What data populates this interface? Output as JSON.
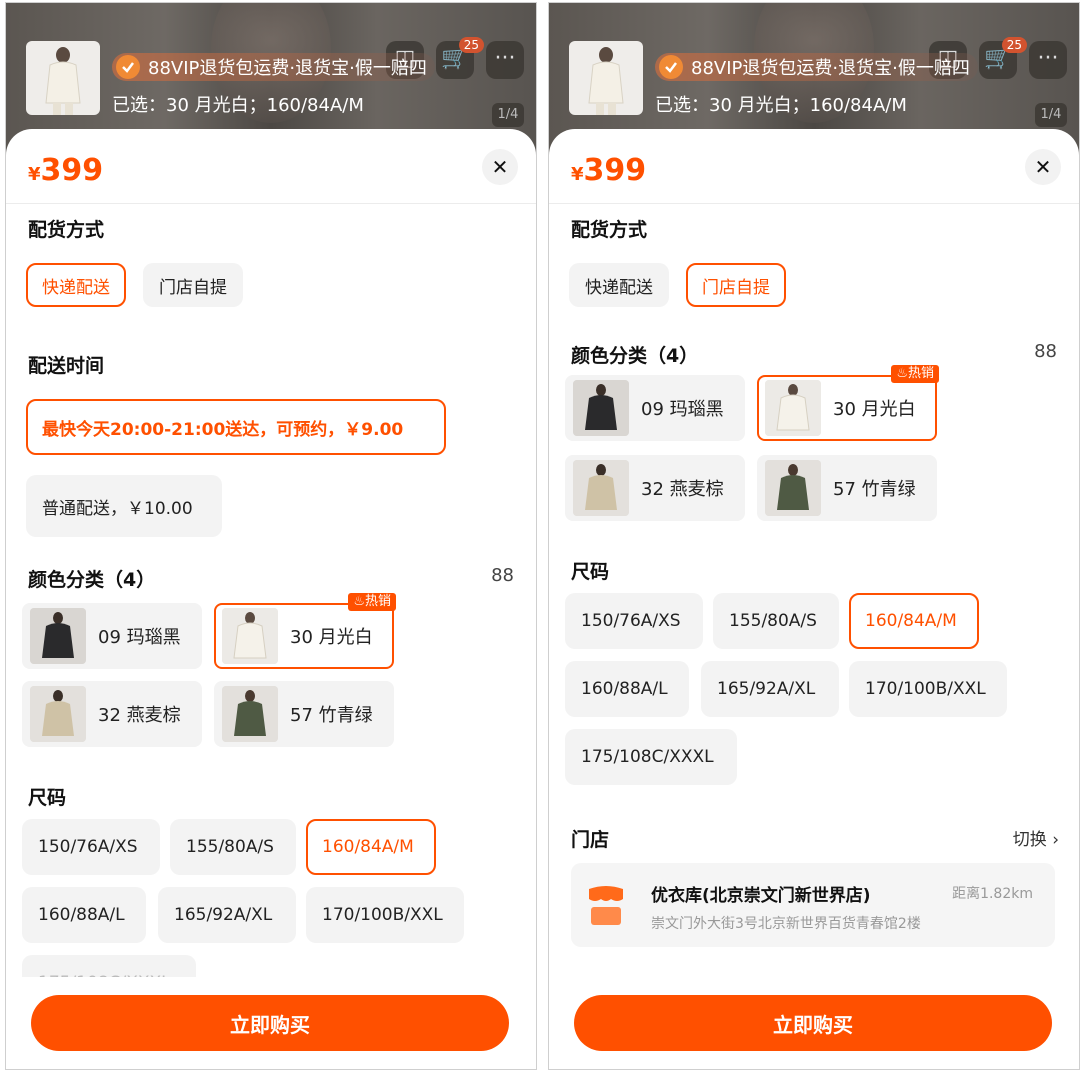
{
  "header": {
    "vip_text": "88VIP退货包运费·退货宝·假一赔四",
    "selected_text": "已选：30 月光白；160/84A/M",
    "cart_badge": "25",
    "pager": "1/4",
    "more_icon": "···"
  },
  "price": {
    "symbol": "¥",
    "value": "399"
  },
  "close_icon": "✕",
  "delivery_method": {
    "title": "配货方式",
    "options": [
      "快递配送",
      "门店自提"
    ]
  },
  "delivery_time": {
    "title": "配送时间",
    "fast": "最快今天20:00-21:00送达，可预约，￥9.00",
    "normal": "普通配送，￥10.00"
  },
  "color": {
    "title": "颜色分类（4）",
    "hot_badge": "热销",
    "options": [
      "09 玛瑙黑",
      "30 月光白",
      "32 燕麦棕",
      "57 竹青绿"
    ],
    "grid_icon": "88"
  },
  "size": {
    "title": "尺码",
    "options": [
      "150/76A/XS",
      "155/80A/S",
      "160/84A/M",
      "160/88A/L",
      "165/92A/XL",
      "170/100B/XXL",
      "175/108C/XXXL"
    ]
  },
  "store": {
    "title": "门店",
    "switch": "切换 ›",
    "name": "优衣库(北京崇文门新世界店)",
    "distance": "距离1.82km",
    "address": "崇文门外大街3号北京新世界百货青春馆2楼"
  },
  "buy_button": "立即购买",
  "colors": {
    "accent": "#ff5000",
    "chip_bg": "#f3f3f3"
  }
}
